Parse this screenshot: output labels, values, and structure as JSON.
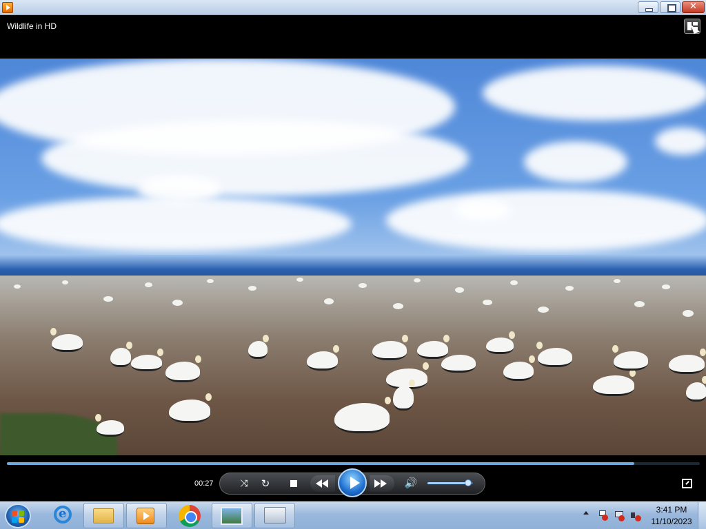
{
  "window": {
    "controls": [
      "minimize",
      "maximize",
      "close"
    ]
  },
  "player": {
    "title": "Wildlife in HD",
    "elapsed": "00:27",
    "progress_fraction": 0.905,
    "volume_fraction": 0.9
  },
  "controls": {
    "shuffle_icon": "shuffle-icon",
    "repeat_icon": "repeat-icon",
    "stop_icon": "stop-icon",
    "previous_icon": "rewind-icon",
    "play_icon": "play-icon",
    "next_icon": "fast-forward-icon",
    "mute_icon": "speaker-icon"
  },
  "taskbar": {
    "pinned": [
      "internet-explorer",
      "windows-explorer",
      "windows-media-player",
      "google-chrome",
      "picture-viewer",
      "on-screen-keyboard"
    ],
    "clock_time": "3:41 PM",
    "clock_date": "11/10/2023"
  },
  "colors": {
    "accent": "#1f6fcf",
    "seek_fill": "#6ea8dd",
    "close_button": "#c43b26"
  }
}
